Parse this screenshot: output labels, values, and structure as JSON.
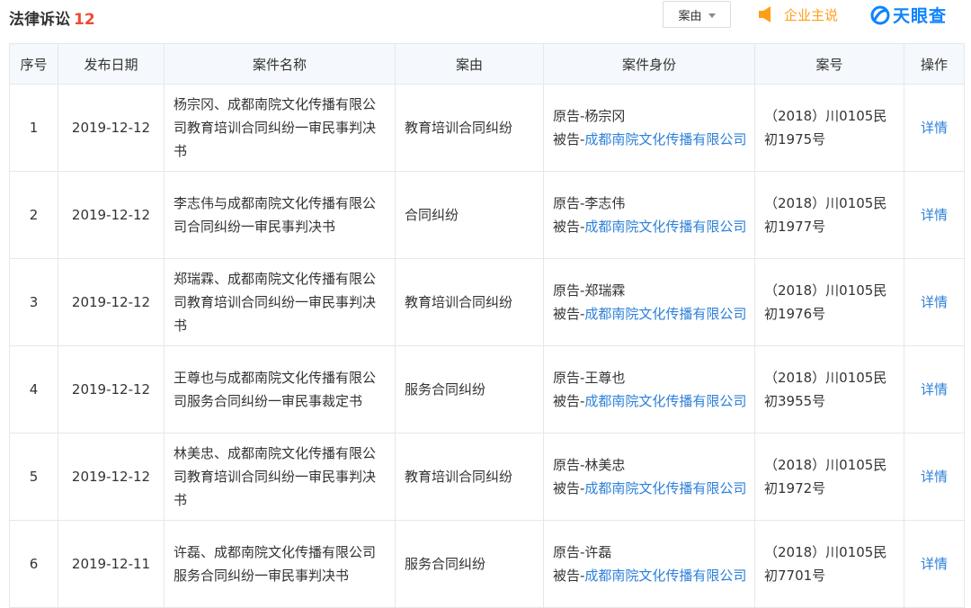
{
  "header": {
    "title": "法律诉讼",
    "count": "12",
    "filter_label": "案由",
    "notice_label": "企业主说",
    "logo_text": "天眼查"
  },
  "colors": {
    "count": "#f04a32",
    "link": "#2e80d9",
    "notice": "#ff9f19",
    "logo": "#0d84ff",
    "header_bg": "#f5f8fc"
  },
  "table": {
    "columns": [
      "序号",
      "发布日期",
      "案件名称",
      "案由",
      "案件身份",
      "案号",
      "操作"
    ],
    "rows": [
      {
        "no": "1",
        "date": "2019-12-12",
        "name": "杨宗冈、成都南院文化传播有限公司教育培训合同纠纷一审民事判决书",
        "cause": "教育培训合同纠纷",
        "plaintiff": "原告-杨宗冈",
        "defendant_prefix": "被告-",
        "defendant": "成都南院文化传播有限公司",
        "case_no": "（2018）川0105民初1975号",
        "action": "详情"
      },
      {
        "no": "2",
        "date": "2019-12-12",
        "name": "李志伟与成都南院文化传播有限公司合同纠纷一审民事判决书",
        "cause": "合同纠纷",
        "plaintiff": "原告-李志伟",
        "defendant_prefix": "被告-",
        "defendant": "成都南院文化传播有限公司",
        "case_no": "（2018）川0105民初1977号",
        "action": "详情"
      },
      {
        "no": "3",
        "date": "2019-12-12",
        "name": "郑瑞霖、成都南院文化传播有限公司教育培训合同纠纷一审民事判决书",
        "cause": "教育培训合同纠纷",
        "plaintiff": "原告-郑瑞霖",
        "defendant_prefix": "被告-",
        "defendant": "成都南院文化传播有限公司",
        "case_no": "（2018）川0105民初1976号",
        "action": "详情"
      },
      {
        "no": "4",
        "date": "2019-12-12",
        "name": "王尊也与成都南院文化传播有限公司服务合同纠纷一审民事裁定书",
        "cause": "服务合同纠纷",
        "plaintiff": "原告-王尊也",
        "defendant_prefix": "被告-",
        "defendant": "成都南院文化传播有限公司",
        "case_no": "（2018）川0105民初3955号",
        "action": "详情"
      },
      {
        "no": "5",
        "date": "2019-12-12",
        "name": "林美忠、成都南院文化传播有限公司教育培训合同纠纷一审民事判决书",
        "cause": "教育培训合同纠纷",
        "plaintiff": "原告-林美忠",
        "defendant_prefix": "被告-",
        "defendant": "成都南院文化传播有限公司",
        "case_no": "（2018）川0105民初1972号",
        "action": "详情"
      },
      {
        "no": "6",
        "date": "2019-12-11",
        "name": "许磊、成都南院文化传播有限公司服务合同纠纷一审民事判决书",
        "cause": "服务合同纠纷",
        "plaintiff": "原告-许磊",
        "defendant_prefix": "被告-",
        "defendant": "成都南院文化传播有限公司",
        "case_no": "（2018）川0105民初7701号",
        "action": "详情"
      }
    ]
  }
}
